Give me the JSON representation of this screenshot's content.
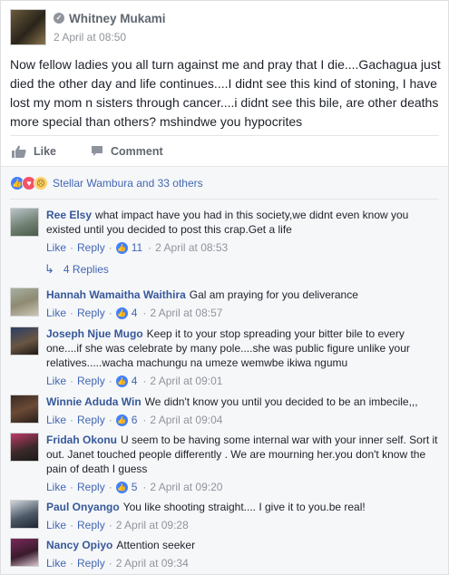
{
  "post": {
    "author": "Whitney Mukami",
    "timestamp": "2 April at 08:50",
    "text": "Now fellow ladies you all turn against me and pray that I die....Gachagua just died the other day and life continues....I didnt see this kind of stoning, I have lost my mom n sisters through cancer....i didnt see this bile, are other deaths more special than others? mshindwe you hypocrites",
    "like_label": "Like",
    "comment_label": "Comment"
  },
  "reactions": {
    "summary": "Stellar Wambura and 33 others",
    "types": [
      "like-icon",
      "love-icon",
      "sad-icon"
    ]
  },
  "comment_actions": {
    "like": "Like",
    "reply": "Reply"
  },
  "comments": [
    {
      "name": "Ree Elsy",
      "text": "what impact have you had in this society,we didnt even know you existed until you decided to post this crap.Get a life",
      "likes": "11",
      "time": "2 April at 08:53",
      "replies": "4 Replies"
    },
    {
      "name": "Hannah Wamaitha Waithira",
      "text": "Gal am praying for you deliverance",
      "likes": "4",
      "time": "2 April at 08:57"
    },
    {
      "name": "Joseph Njue Mugo",
      "text": "Keep it to your stop spreading your bitter bile to every one....if she was celebrate by many pole....she was public figure unlike your relatives.....wacha machungu na umeze wemwbe ikiwa ngumu",
      "likes": "4",
      "time": "2 April at 09:01"
    },
    {
      "name": "Winnie Aduda Win",
      "text": "We didn't know you until you decided to be an imbecile,,,",
      "likes": "6",
      "time": "2 April at 09:04"
    },
    {
      "name": "Fridah Okonu",
      "text": "U seem to be having some internal war with your inner self. Sort it out. Janet touched people differently . We are mourning her.you don't know the pain of death I guess",
      "likes": "5",
      "time": "2 April at 09:20"
    },
    {
      "name": "Paul Onyango",
      "text": "You like shooting straight.... I give it to you.be real!",
      "likes": "",
      "time": "2 April at 09:28"
    },
    {
      "name": "Nancy Opiyo",
      "text": "Attention seeker",
      "likes": "",
      "time": "2 April at 09:34"
    }
  ],
  "colors": {
    "link": "#365899",
    "like_blue": "#4080ff",
    "love_red": "#f25268",
    "meta_gray": "#90949c"
  }
}
